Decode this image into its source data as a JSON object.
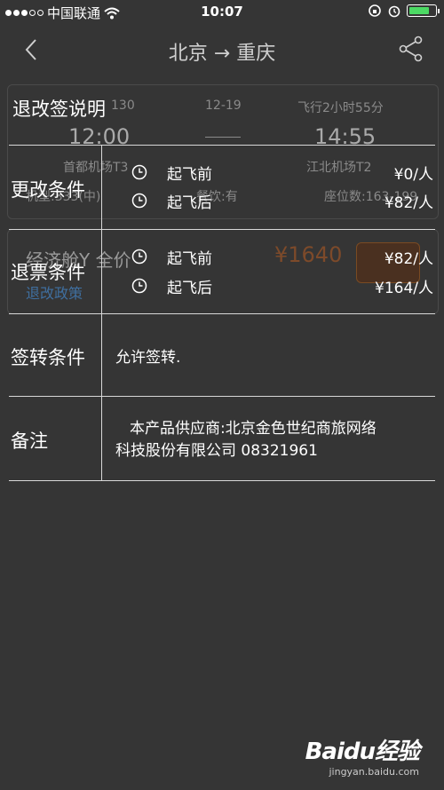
{
  "status_bar": {
    "carrier": "中国联通",
    "time": "10:07",
    "battery_level": 0.8
  },
  "nav": {
    "title": "北京 → 重庆"
  },
  "flight_card": {
    "flight_no_fragment": "130",
    "date": "12-19",
    "duration": "飞行2小时55分",
    "dep_time": "12:00",
    "arr_time": "14:55",
    "dep_airport": "首都机场T3",
    "arr_airport": "江北机场T2",
    "aircraft": "机型:333(中)",
    "meal": "餐饮:有",
    "seats": "座位数:163-199"
  },
  "fare": {
    "name": "经济舱Y 全价",
    "policy": "退改政策",
    "price": "¥1640"
  },
  "dialog": {
    "title": "退改签说明",
    "change": {
      "label": "更改条件",
      "rows": [
        {
          "when": "起飞前",
          "fee": "¥0/人"
        },
        {
          "when": "起飞后",
          "fee": "¥82/人"
        }
      ]
    },
    "refund": {
      "label": "退票条件",
      "rows": [
        {
          "when": "起飞前",
          "fee": "¥82/人"
        },
        {
          "when": "起飞后",
          "fee": "¥164/人"
        }
      ]
    },
    "endorse": {
      "label": "签转条件",
      "text": "允许签转."
    },
    "remark": {
      "label": "备注",
      "line1": "本产品供应商:北京金色世纪商旅网络",
      "line2": "科技股份有限公司 08321961"
    }
  },
  "watermark": {
    "logo": "Baidu经验",
    "url": "jingyan.baidu.com"
  }
}
